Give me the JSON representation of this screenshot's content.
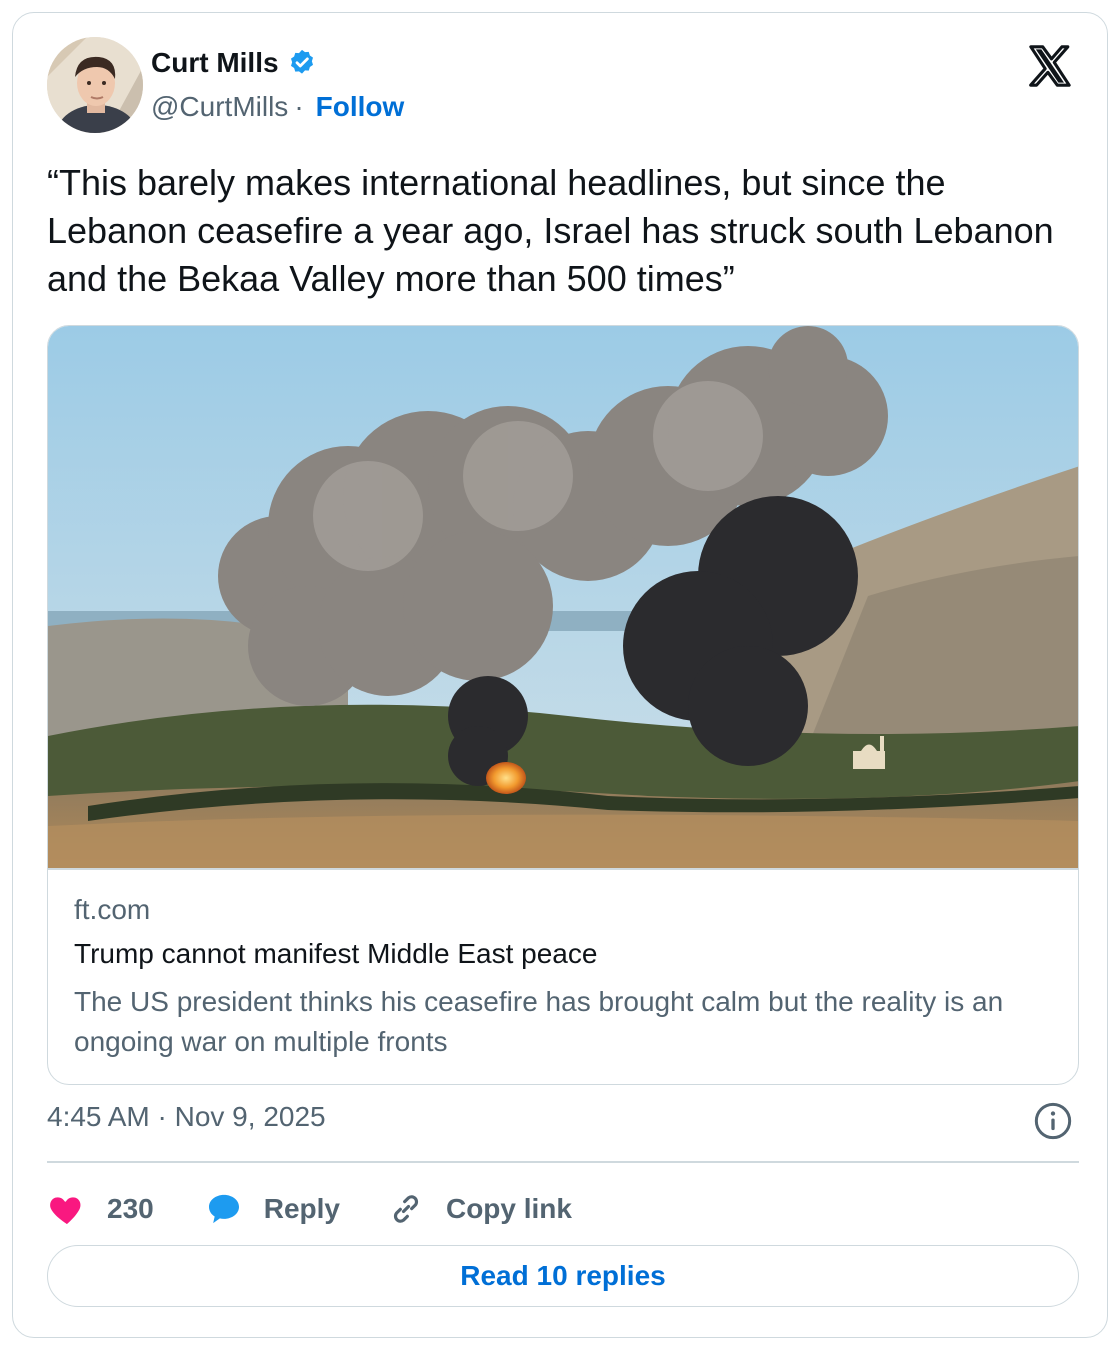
{
  "author": {
    "name": "Curt Mills",
    "handle": "@CurtMills",
    "separator": "·",
    "follow_label": "Follow"
  },
  "icons": {
    "verified": "verified-badge-icon",
    "brand": "x-logo-icon",
    "info": "info-icon",
    "like": "heart-icon",
    "reply": "speech-bubble-icon",
    "copy": "link-icon"
  },
  "tweet": {
    "text": "“This barely makes international headlines, but since the Lebanon ceasefire a year ago, Israel has struck south Lebanon and the Bekaa Valley more than 500 times”",
    "timestamp": "4:45 AM · Nov 9, 2025"
  },
  "link_card": {
    "domain": "ft.com",
    "headline": "Trump cannot manifest Middle East peace",
    "description": "The US president thinks his ceasefire has brought calm but the reality is an ongoing war on multiple fronts"
  },
  "actions": {
    "like_count": "230",
    "reply_label": "Reply",
    "copy_label": "Copy link",
    "read_replies_label": "Read 10 replies"
  },
  "colors": {
    "accent": "#006fd6",
    "like": "#f91880",
    "reply": "#1d9bf0",
    "secondary_text": "#536471",
    "border": "#cfd9de"
  }
}
